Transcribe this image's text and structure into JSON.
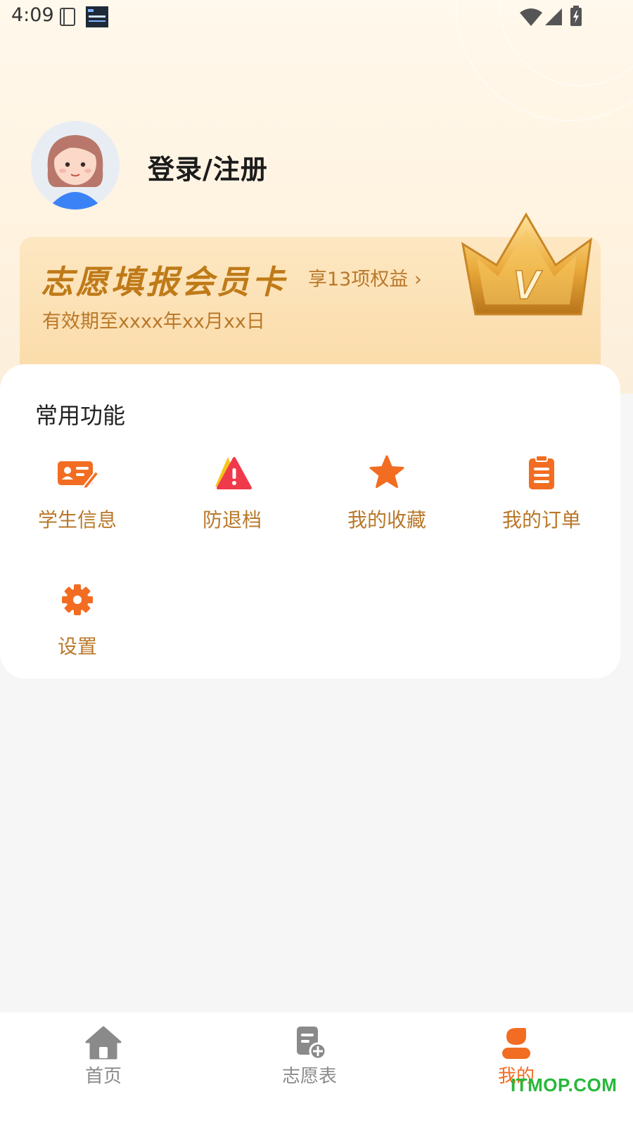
{
  "status_bar": {
    "time": "4:09"
  },
  "profile": {
    "login_label": "登录/注册"
  },
  "vip_card": {
    "title": "志愿填报会员卡",
    "benefit": "享13项权益 ›",
    "expire": "有效期至xxxx年xx月xx日",
    "crown_letter": "V"
  },
  "functions": {
    "title": "常用功能",
    "items": [
      {
        "label": "学生信息",
        "icon": "student-card-icon"
      },
      {
        "label": "防退档",
        "icon": "warning-triangle-icon"
      },
      {
        "label": "我的收藏",
        "icon": "star-icon"
      },
      {
        "label": "我的订单",
        "icon": "clipboard-icon"
      },
      {
        "label": "设置",
        "icon": "gear-icon"
      }
    ]
  },
  "tabbar": {
    "tabs": [
      {
        "label": "首页",
        "icon": "home-icon"
      },
      {
        "label": "志愿表",
        "icon": "form-add-icon"
      },
      {
        "label": "我的",
        "icon": "person-icon",
        "active": true
      }
    ]
  },
  "watermark": "ITMOP.COM",
  "colors": {
    "accent": "#f26d21",
    "label_gold": "#b9782a",
    "vip_title": "#bf7a18",
    "danger": "#f03a4b",
    "tab_inactive": "#8a8a8a"
  }
}
